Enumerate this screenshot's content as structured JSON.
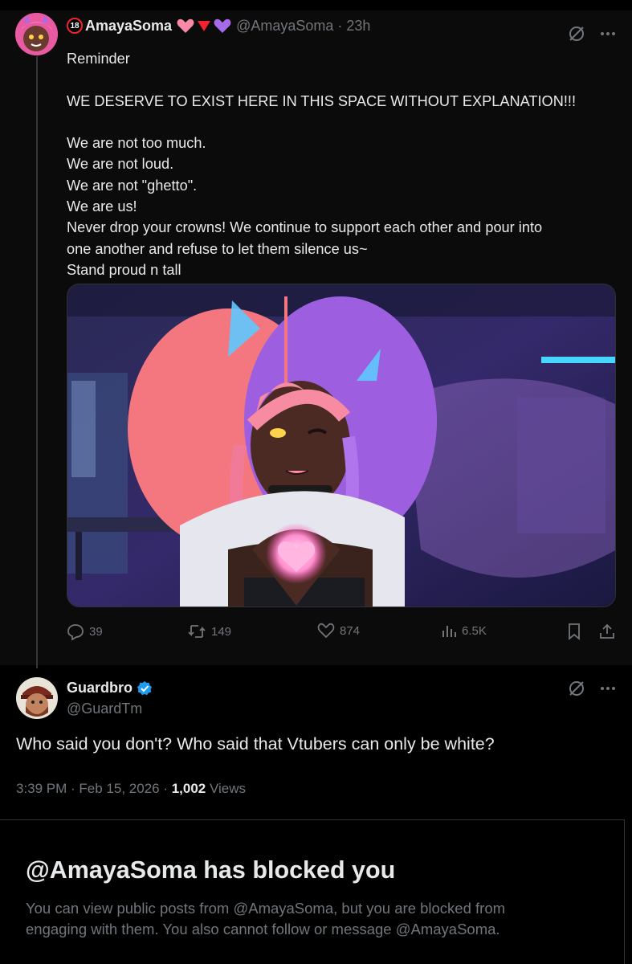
{
  "post": {
    "badge": "18",
    "display_name": "AmayaSoma",
    "name_emojis": [
      "pink-heart",
      "red-triangle",
      "purple-heart"
    ],
    "handle": "@AmayaSoma",
    "time": "· 23h",
    "text_lines": [
      "Reminder",
      "",
      "WE DESERVE TO EXIST HERE IN THIS SPACE WITHOUT EXPLANATION!!!",
      "",
      "We are not too much.",
      "We are not loud.",
      "We are not \"ghetto\".",
      "We are us!",
      "Never drop your crowns! We continue to support each other and pour into",
      "one another and refuse to let them silence us~",
      "Stand proud n tall"
    ],
    "media_icon_names": [
      "vtuber-avatar-image"
    ],
    "actions": {
      "replies": "39",
      "reposts": "149",
      "likes": "874",
      "views": "6.5K"
    }
  },
  "reply": {
    "display_name": "Guardbro",
    "verified": true,
    "handle": "@GuardTm",
    "text": "Who said you don't? Who said that Vtubers can only be white?",
    "timestamp": "3:39 PM · Feb 15, 2026 · ",
    "views_count": "1,002",
    "views_label": " Views"
  },
  "blocked": {
    "title": "@AmayaSoma has blocked you",
    "line1": "You can view public posts from @AmayaSoma, but you are blocked from",
    "line2": "engaging with them. You also cannot follow or message @AmayaSoma."
  },
  "colors": {
    "background": "#000000",
    "card": "#0b0b0b",
    "text": "#e7e9ea",
    "muted": "#71767b",
    "verified": "#1d9bf0",
    "pink": "#f98aa7",
    "purple": "#a56be8"
  }
}
